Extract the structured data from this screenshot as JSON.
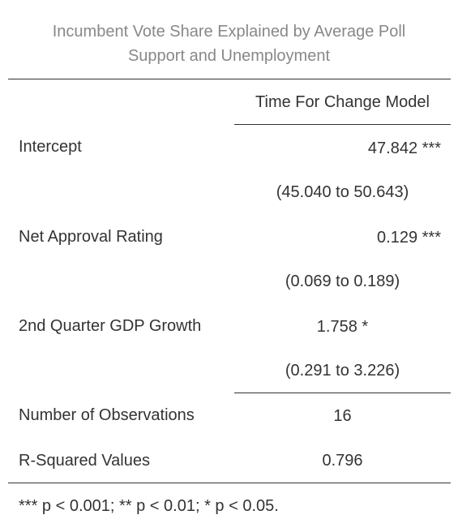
{
  "title": {
    "line1": "Incumbent Vote Share Explained by Average Poll",
    "line2": "Support and Unemployment"
  },
  "table": {
    "column_header": "Time For Change Model",
    "rows": [
      {
        "label": "Intercept",
        "estimate": "47.842 ***",
        "ci": "(45.040 to 50.643)"
      },
      {
        "label": "Net Approval Rating",
        "estimate": "0.129 ***",
        "ci": "(0.069 to 0.189)"
      },
      {
        "label": "2nd Quarter GDP Growth",
        "estimate": "1.758 *",
        "ci": "(0.291 to 3.226)"
      }
    ],
    "stats": [
      {
        "label": "Number of Observations",
        "value": "16"
      },
      {
        "label": "R-Squared Values",
        "value": "0.796"
      }
    ],
    "footnote": "*** p < 0.001; ** p < 0.01; * p < 0.05."
  }
}
